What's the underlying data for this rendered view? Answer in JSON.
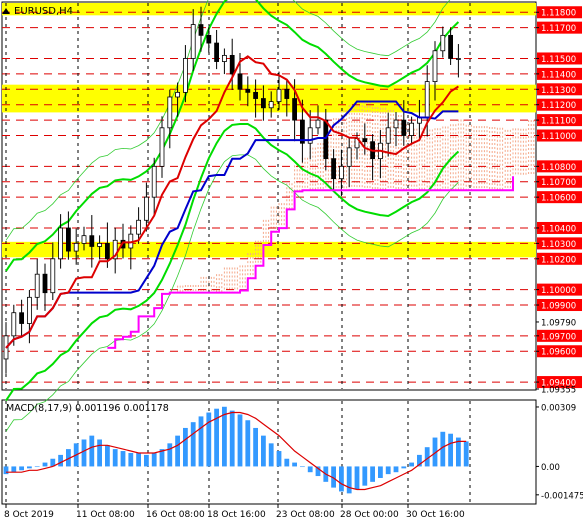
{
  "symbol_label": "EURUSD,H4",
  "macd_label": "MACD(8,17,9) 0.001196 0.001178",
  "colors": {
    "price_bg": "#ff0000",
    "price_text": "#ffffff",
    "zone": "#ffff00",
    "candle": "#000000",
    "channel_green": "#00dd00",
    "channel_thin": "#33cc33",
    "kijun": "#0000cc",
    "tenkan": "#dd0000",
    "chikou_magenta": "#ff00ff",
    "cloud_a": "#f4a98a",
    "cloud_b": "#c9c9c9",
    "hist": "#3399ff",
    "signal": "#dd0000",
    "support_line": "#dd0000"
  },
  "chart_data": [
    {
      "type": "candlestick",
      "name": "EURUSD H4",
      "y_axis": [
        "1.11800",
        "1.11700",
        "1.11500",
        "1.11400",
        "1.11300",
        "1.11200",
        "1.11100",
        "1.11000",
        "1.10800",
        "1.10700",
        "1.10600",
        "1.10400",
        "1.10300",
        "1.10200",
        "1.10000",
        "1.09900",
        "1.09790",
        "1.09700",
        "1.09600",
        "1.09400",
        "1.09355"
      ],
      "price_labels_highlighted": [
        "1.11800",
        "1.11700",
        "1.11500",
        "1.11400",
        "1.11300",
        "1.11200",
        "1.11100",
        "1.11000",
        "1.10800",
        "1.10700",
        "1.10600",
        "1.10400",
        "1.10300",
        "1.10200",
        "1.10000",
        "1.09900",
        "1.09700",
        "1.09600",
        "1.09400"
      ],
      "x_axis": [
        "8 Oct 2019",
        "11 Oct 08:00",
        "16 Oct 08:00",
        "18 Oct 16:00",
        "23 Oct 08:00",
        "28 Oct 00:00",
        "30 Oct 16:00"
      ],
      "ylim": [
        1.09355,
        1.1186
      ],
      "support_resistance_levels": [
        1.118,
        1.117,
        1.115,
        1.114,
        1.113,
        1.112,
        1.111,
        1.11,
        1.108,
        1.107,
        1.106,
        1.104,
        1.103,
        1.102,
        1.1,
        1.099,
        1.097,
        1.096,
        1.094
      ],
      "highlight_zones": [
        [
          1.1178,
          1.1186
        ],
        [
          1.1115,
          1.1133
        ],
        [
          1.1021,
          1.1031
        ]
      ],
      "closes": [
        1.097,
        1.0985,
        1.0978,
        1.0995,
        1.101,
        1.0998,
        1.102,
        1.104,
        1.1025,
        1.103,
        1.1035,
        1.1028,
        1.103,
        1.102,
        1.1032,
        1.1027,
        1.1036,
        1.1045,
        1.106,
        1.108,
        1.1105,
        1.1125,
        1.1128,
        1.115,
        1.1172,
        1.1165,
        1.116,
        1.1148,
        1.1152,
        1.114,
        1.113,
        1.1128,
        1.1124,
        1.1118,
        1.1122,
        1.113,
        1.1124,
        1.111,
        1.1095,
        1.1105,
        1.111,
        1.1085,
        1.1072,
        1.108,
        1.1092,
        1.1098,
        1.1096,
        1.1085,
        1.1095,
        1.1105,
        1.111,
        1.11,
        1.1108,
        1.1112,
        1.1135,
        1.1155,
        1.1165,
        1.115,
        1.115
      ]
    },
    {
      "type": "bar",
      "name": "MACD(8,17,9)",
      "y_axis": [
        "0.00309",
        "0.00",
        "-0.001475"
      ],
      "ylim": [
        -0.0019,
        0.0034
      ],
      "histogram": [
        -0.0004,
        -0.0003,
        -0.0002,
        -0.0001,
        0.0,
        0.0002,
        0.0004,
        0.0006,
        0.0009,
        0.0012,
        0.0014,
        0.0016,
        0.0014,
        0.0011,
        0.0009,
        0.0008,
        0.0007,
        0.0007,
        0.0006,
        0.0007,
        0.0009,
        0.0012,
        0.0016,
        0.002,
        0.0023,
        0.0026,
        0.0028,
        0.003,
        0.0031,
        0.0029,
        0.0027,
        0.0024,
        0.002,
        0.0016,
        0.0012,
        0.0008,
        0.0004,
        0.0002,
        0.0,
        -0.0003,
        -0.0005,
        -0.0008,
        -0.0011,
        -0.0013,
        -0.0014,
        -0.0012,
        -0.001,
        -0.0008,
        -0.0006,
        -0.0004,
        -0.0003,
        -0.0001,
        0.0002,
        0.0006,
        0.001,
        0.0015,
        0.0018,
        0.0017,
        0.0015,
        0.0013
      ],
      "signal_line": [
        -0.0003,
        -0.0003,
        -0.0003,
        -0.0002,
        -0.0002,
        -0.0001,
        0.0,
        0.0002,
        0.0004,
        0.0006,
        0.0008,
        0.001,
        0.0011,
        0.0011,
        0.001,
        0.0009,
        0.0008,
        0.0007,
        0.0007,
        0.0007,
        0.0008,
        0.0009,
        0.0011,
        0.0014,
        0.0017,
        0.002,
        0.0023,
        0.0025,
        0.0027,
        0.0028,
        0.0028,
        0.0027,
        0.0025,
        0.0022,
        0.0019,
        0.0016,
        0.0012,
        0.0008,
        0.0005,
        0.0002,
        -0.0001,
        -0.0004,
        -0.0006,
        -0.0009,
        -0.0011,
        -0.0012,
        -0.0012,
        -0.0011,
        -0.001,
        -0.0008,
        -0.0006,
        -0.0004,
        -0.0002,
        0.0001,
        0.0004,
        0.0007,
        0.001,
        0.0012,
        0.0013,
        0.0013
      ],
      "zero_line_color": "#000000"
    }
  ]
}
